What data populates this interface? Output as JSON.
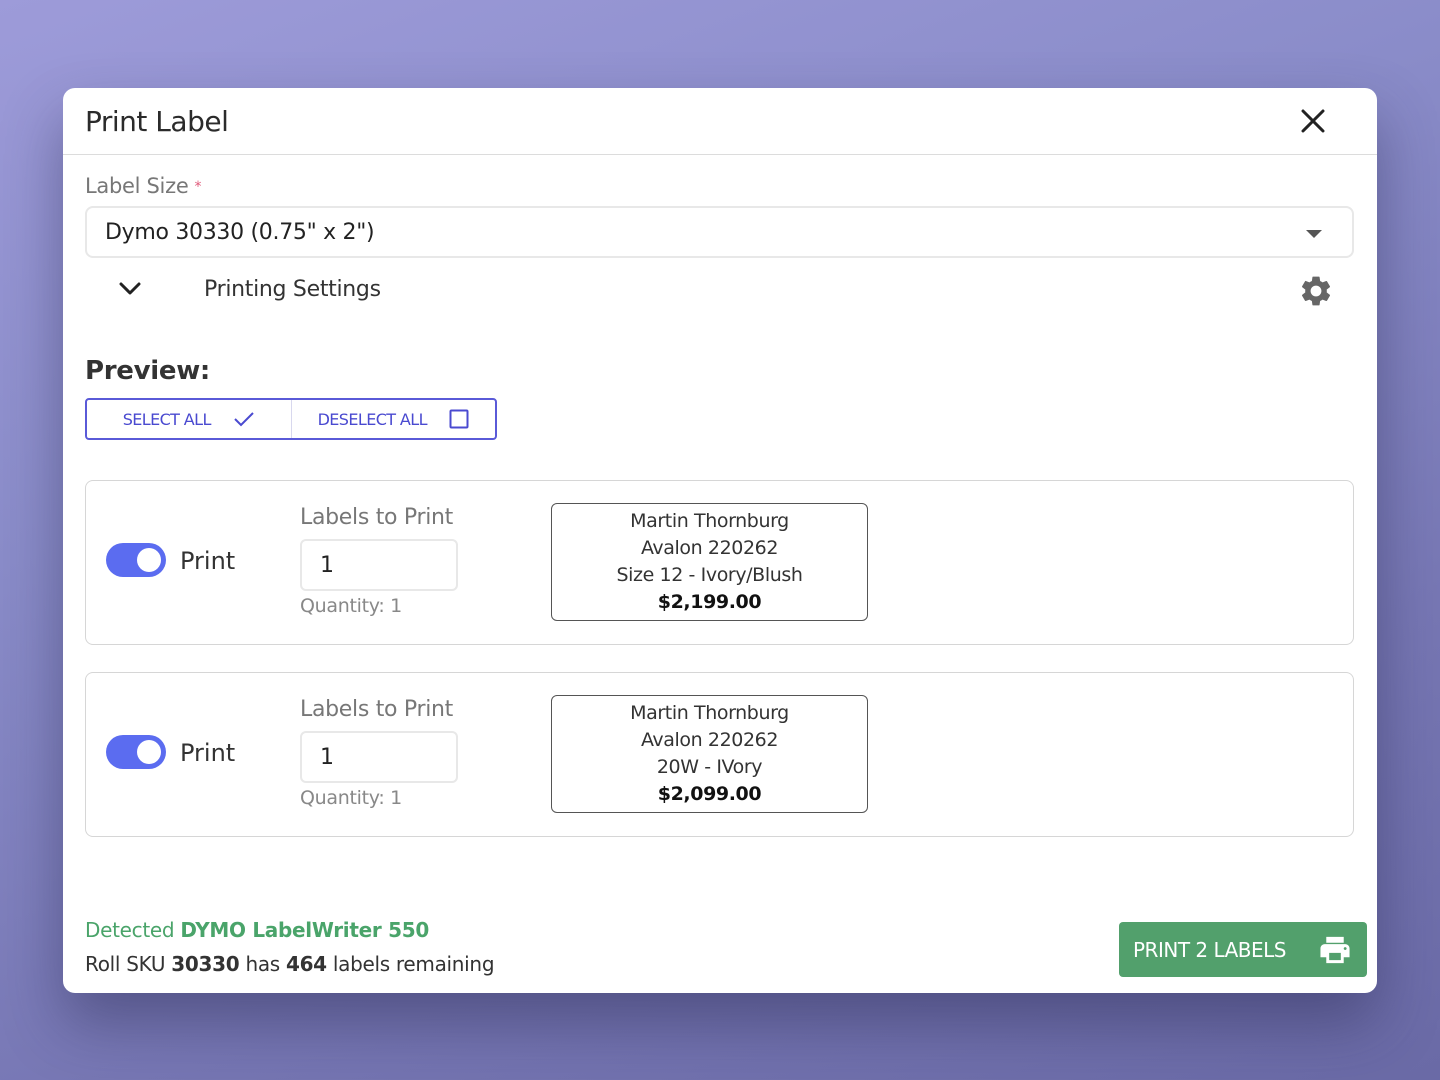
{
  "dialog": {
    "title": "Print Label",
    "close_icon": "close-icon"
  },
  "label_size": {
    "label": "Label Size",
    "required_marker": "*",
    "selected": "Dymo 30330 (0.75\" x 2\")"
  },
  "printing_settings": {
    "label": "Printing Settings",
    "expanded_icon": "chevron-down-icon",
    "settings_icon": "gear-icon"
  },
  "preview": {
    "title": "Preview:",
    "select_all": "SELECT ALL",
    "deselect_all": "DESELECT ALL"
  },
  "items": [
    {
      "print_enabled": true,
      "print_label": "Print",
      "labels_to_print_label": "Labels to Print",
      "labels_to_print": "1",
      "quantity_note": "Quantity: 1",
      "label_lines": [
        "Martin Thornburg",
        "Avalon 220262",
        "Size 12 - Ivory/Blush"
      ],
      "price": "$2,199.00"
    },
    {
      "print_enabled": true,
      "print_label": "Print",
      "labels_to_print_label": "Labels to Print",
      "labels_to_print": "1",
      "quantity_note": "Quantity: 1",
      "label_lines": [
        "Martin Thornburg",
        "Avalon 220262",
        "20W - IVory"
      ],
      "price": "$2,099.00"
    }
  ],
  "footer": {
    "detected_prefix": "Detected",
    "printer_name": "DYMO LabelWriter 550",
    "roll_prefix": "Roll SKU",
    "roll_sku": "30330",
    "roll_mid": "has",
    "labels_remaining": "464",
    "roll_suffix": "labels remaining",
    "print_button": "PRINT 2 LABELS"
  },
  "colors": {
    "accent": "#5a5ad8",
    "toggle_on": "#5b6cf0",
    "success": "#52a06c"
  }
}
